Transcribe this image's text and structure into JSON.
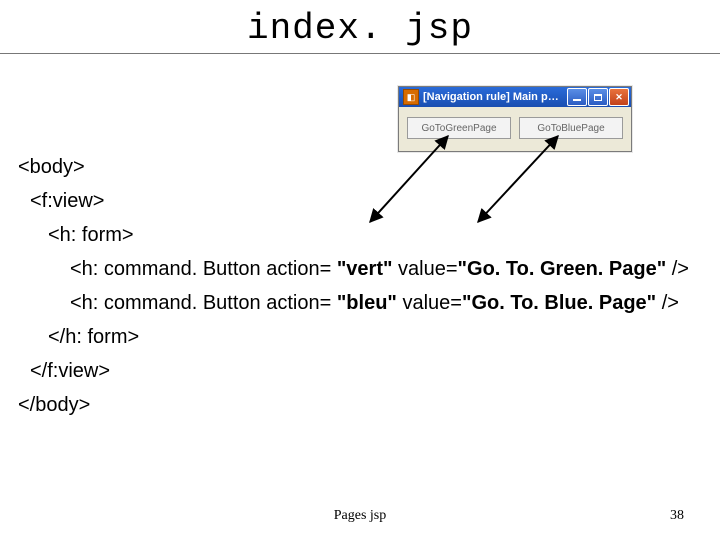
{
  "title": "index. jsp",
  "window": {
    "title": "[Navigation rule] Main page…",
    "buttons": [
      "GoToGreenPage",
      "GoToBluePage"
    ]
  },
  "code": {
    "0": "<body>",
    "1": "<f:view>",
    "2": "<h: form>",
    "5": "</h: form>",
    "6": "</f:view>",
    "7": "</body>"
  },
  "code_parts": {
    "cmd_prefix": "<h: command. Button action= ",
    "vert_action": "\"vert\"",
    "bleu_action": "\"bleu\"",
    "value_eq": " value=",
    "green_value": "\"Go. To. Green. Page\"",
    "blue_value": "\"Go. To. Blue. Page\"",
    "close": " />"
  },
  "footer": {
    "label": "Pages jsp",
    "page": "38"
  }
}
